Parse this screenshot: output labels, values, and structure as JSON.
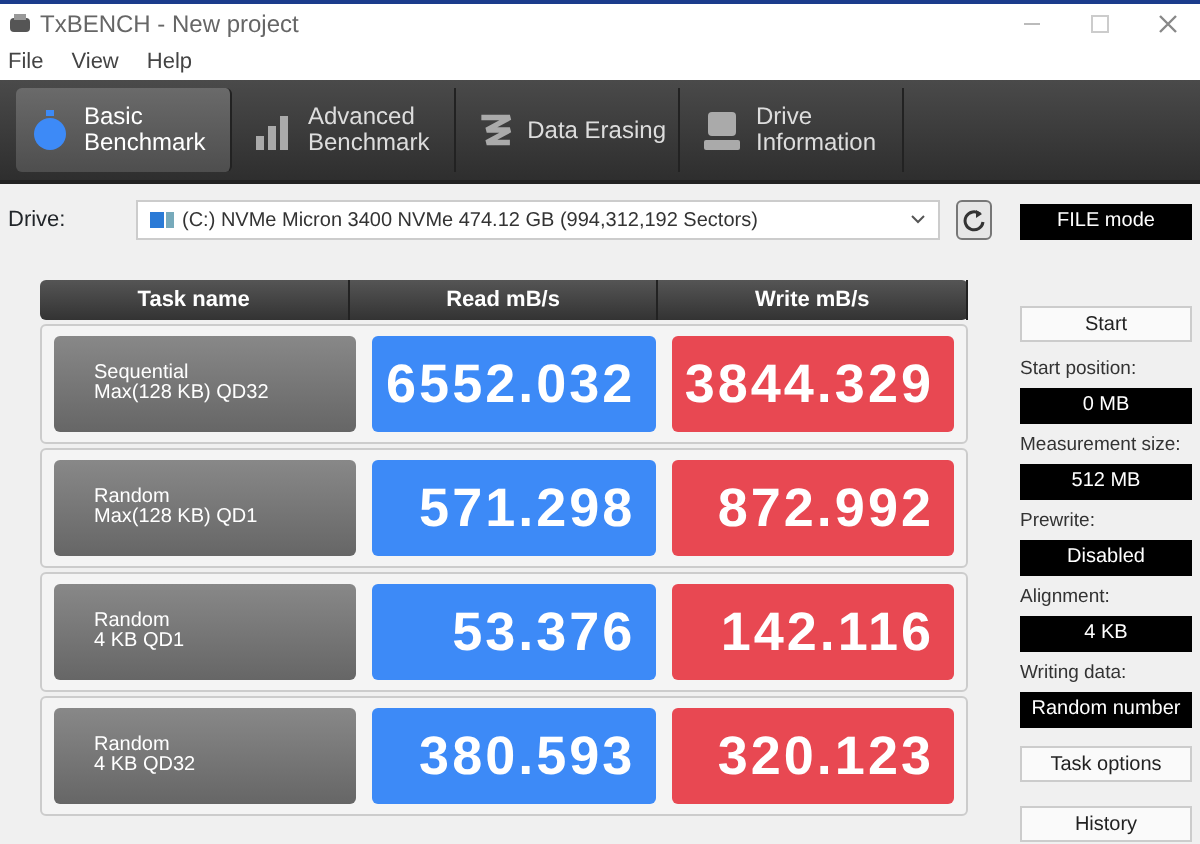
{
  "window": {
    "title": "TxBENCH - New project"
  },
  "menu": [
    "File",
    "View",
    "Help"
  ],
  "tabs": [
    {
      "label": "Basic\nBenchmark",
      "selected": true
    },
    {
      "label": "Advanced\nBenchmark",
      "selected": false
    },
    {
      "label": "Data Erasing",
      "selected": false
    },
    {
      "label": "Drive\nInformation",
      "selected": false
    }
  ],
  "drive": {
    "label": "Drive:",
    "value": "(C:) NVMe Micron 3400 NVMe  474.12 GB (994,312,192 Sectors)"
  },
  "mode": "FILE mode",
  "table": {
    "columns": [
      "Task name",
      "Read mB/s",
      "Write mB/s"
    ],
    "rows": [
      {
        "task": "Sequential\nMax(128 KB) QD32",
        "read": "6552.032",
        "write": "3844.329"
      },
      {
        "task": "Random\nMax(128 KB) QD1",
        "read": "571.298",
        "write": "872.992"
      },
      {
        "task": "Random\n4 KB QD1",
        "read": "53.376",
        "write": "142.116"
      },
      {
        "task": "Random\n4 KB QD32",
        "read": "380.593",
        "write": "320.123"
      }
    ]
  },
  "start_button": "Start",
  "settings": [
    {
      "label": "Start position:",
      "value": "0 MB"
    },
    {
      "label": "Measurement size:",
      "value": "512 MB"
    },
    {
      "label": "Prewrite:",
      "value": "Disabled"
    },
    {
      "label": "Alignment:",
      "value": "4 KB"
    },
    {
      "label": "Writing data:",
      "value": "Random number"
    }
  ],
  "buttons": [
    "Task options",
    "History"
  ]
}
